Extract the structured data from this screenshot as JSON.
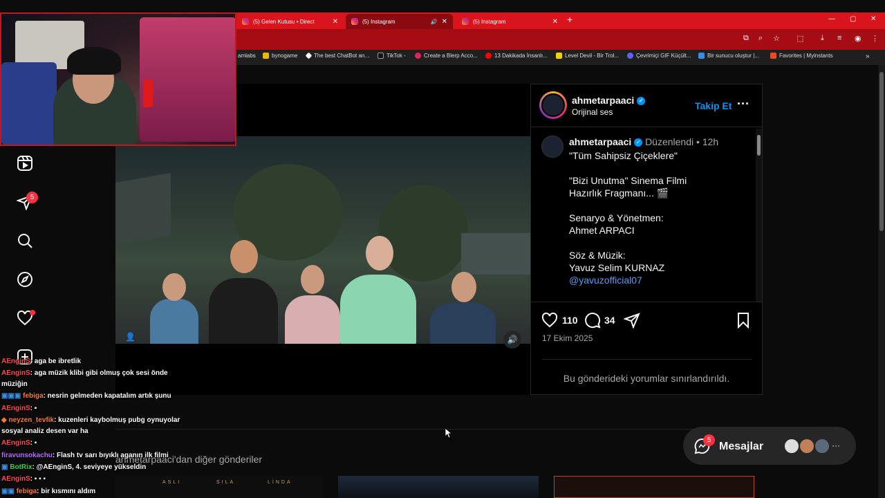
{
  "browser": {
    "tabs": [
      {
        "title": "(5) Gelen Kutusu • Direct"
      },
      {
        "title": "(5) Instagram"
      },
      {
        "title": "(5) Instagram"
      }
    ],
    "new_tab_icon": "plus-icon",
    "window_controls": [
      "minimize-icon",
      "restore-icon",
      "close-icon"
    ],
    "bookmarks": [
      {
        "label": "amlabs",
        "color": "#888888"
      },
      {
        "label": "bynogame",
        "color": "#e6b800"
      },
      {
        "label": "The best ChatBot an...",
        "color": "#ffffff"
      },
      {
        "label": "TikTok -",
        "color": "#111111"
      },
      {
        "label": "Create a Blerp Acco...",
        "color": "#e0245e"
      },
      {
        "label": "13 Dakikada İnsanlı...",
        "color": "#ff0000"
      },
      {
        "label": "Level Devil - Bir Trol...",
        "color": "#f5d000"
      },
      {
        "label": "Çevrimiçi GIF Küçült...",
        "color": "#6a5cff"
      },
      {
        "label": "Bir sunucu oluştur |...",
        "color": "#3a8dde"
      },
      {
        "label": "Favorites | Myinstants",
        "color": "#e34c26"
      }
    ]
  },
  "sidebar": {
    "messages_badge": "5",
    "icons": [
      "reels-icon",
      "direct-send-icon",
      "search-icon",
      "explore-compass-icon",
      "notifications-heart-icon",
      "create-plus-icon"
    ]
  },
  "post": {
    "header": {
      "username": "ahmetarpaaci",
      "audio": "Orijinal ses",
      "follow_label": "Takip Et",
      "more_icon": "more-dots-icon"
    },
    "caption": {
      "username": "ahmetarpaaci",
      "edited": "Düzenlendi",
      "separator": "•",
      "time": "12h",
      "lines": [
        "\"Tüm Sahipsiz Çiçeklere\"",
        "",
        "\"Bizi Unutma\" Sinema Filmi",
        "Hazırlık Fragmanı... 🎬",
        "",
        "Senaryo & Yönetmen:",
        "Ahmet ARPACI",
        "",
        "Söz & Müzik:",
        "Yavuz Selim KURNAZ"
      ],
      "mention": "@yavuzofficial07"
    },
    "likes": "110",
    "comments": "34",
    "date": "17 Ekim 2025",
    "comments_restricted": "Bu gönderideki yorumlar sınırlandırıldı."
  },
  "more_posts_label": "ahmetarpaaci'dan diğer gönderiler",
  "messages_widget": {
    "label": "Mesajlar",
    "badge": "5"
  },
  "chat": [
    {
      "user": "AEnginS",
      "text": ": aga be ibretlik",
      "color": "#ff4a4a"
    },
    {
      "user": "AEnginS",
      "text": ": aga müzik klibi gibi olmuş çok sesi önde",
      "color": "#ff4a4a"
    },
    {
      "user": "",
      "text": "müziğin",
      "color": ""
    },
    {
      "user": "febiga",
      "text": ": nesrin gelmeden kapatalım artık şunu",
      "color": "#ff7a2e"
    },
    {
      "user": "AEnginS",
      "text": ":",
      "color": "#ff4a4a"
    },
    {
      "user": "neyzen_tevfik",
      "text": ": kuzenleri kaybolmuş pubg oynuyolar",
      "color": "#ff7a2e"
    },
    {
      "user": "",
      "text": "sosyal analiz desen var ha",
      "color": ""
    },
    {
      "user": "AEnginS",
      "text": ":",
      "color": "#ff4a4a"
    },
    {
      "user": "firavunsokachu",
      "text": ": Flash tv sarı bıyıklı aganın ilk filmi",
      "color": "#b66dff"
    },
    {
      "user": "BotRix",
      "text": ": @AEnginS, 4. seviyeye yükseldin",
      "color": "#3ecf4a"
    },
    {
      "user": "AEnginS",
      "text": ":",
      "color": "#ff4a4a"
    },
    {
      "user": "febiga",
      "text": ": bir kısmını aldım",
      "color": "#ff7a2e"
    }
  ],
  "bottom_thumbs": {
    "names": [
      "ASLI",
      "SILA",
      "LİNDA"
    ]
  },
  "colors": {
    "tabstrip": "#d9141c",
    "instagram_blue": "#0095f6",
    "badge": "#ff3040"
  }
}
